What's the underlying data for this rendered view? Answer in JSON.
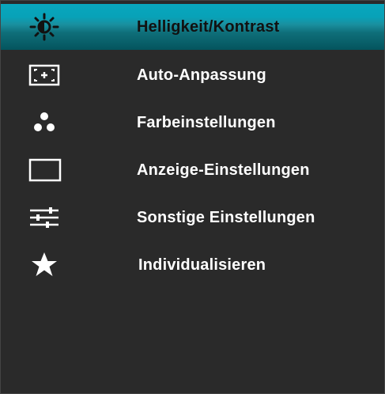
{
  "menu": {
    "items": [
      {
        "label": "Helligkeit/Kontrast",
        "icon": "brightness-contrast-icon",
        "selected": true
      },
      {
        "label": "Auto-Anpassung",
        "icon": "auto-adjust-icon",
        "selected": false
      },
      {
        "label": "Farbeinstellungen",
        "icon": "color-dots-icon",
        "selected": false
      },
      {
        "label": "Anzeige-Einstellungen",
        "icon": "display-rectangle-icon",
        "selected": false
      },
      {
        "label": "Sonstige Einstellungen",
        "icon": "sliders-icon",
        "selected": false
      },
      {
        "label": "Individualisieren",
        "icon": "star-icon",
        "selected": false
      }
    ]
  },
  "colors": {
    "background": "#2a2a2a",
    "selection": "#08a2b8",
    "text": "#ffffff",
    "selected_text": "#111111"
  }
}
